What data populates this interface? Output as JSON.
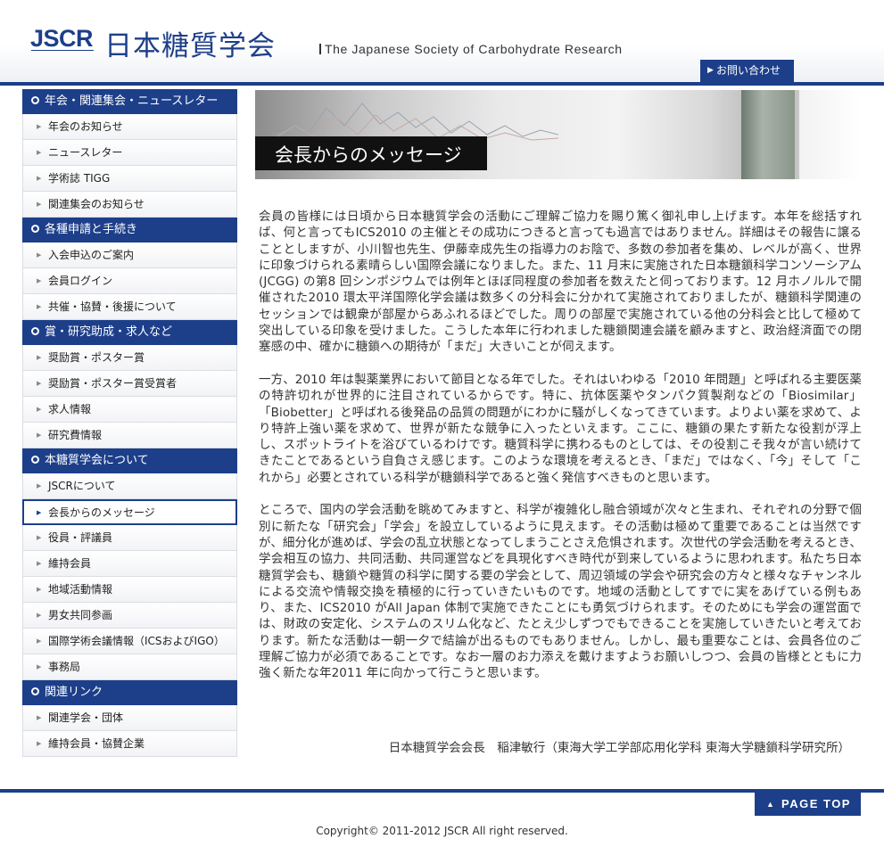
{
  "header": {
    "logo_mark": "JSCR",
    "logo_jp": "日本糖質学会",
    "logo_en": "The Japanese Society of Carbohydrate Research",
    "contact": "お問い合わせ"
  },
  "sidebar": [
    {
      "title": "年会・関連集会・ニュースレター",
      "items": [
        "年会のお知らせ",
        "ニュースレター",
        "学術誌 TIGG",
        "関連集会のお知らせ"
      ]
    },
    {
      "title": "各種申請と手続き",
      "items": [
        "入会申込のご案内",
        "会員ログイン",
        "共催・協賛・後援について"
      ]
    },
    {
      "title": "賞・研究助成・求人など",
      "items": [
        "奨励賞・ポスター賞",
        "奨励賞・ポスター賞受賞者",
        "求人情報",
        "研究費情報"
      ]
    },
    {
      "title": "本糖質学会について",
      "items": [
        "JSCRについて",
        "会長からのメッセージ",
        "役員・評議員",
        "維持会員",
        "地域活動情報",
        "男女共同参画",
        "国際学術会議情報（ICSおよびIGO）",
        "事務局"
      ]
    },
    {
      "title": "関連リンク",
      "items": [
        "関連学会・団体",
        "維持会員・協賛企業"
      ]
    }
  ],
  "active_item": "会長からのメッセージ",
  "hero": {
    "title": "会長からのメッセージ"
  },
  "content": {
    "paragraphs": [
      "会員の皆様には日頃から日本糖質学会の活動にご理解ご協力を賜り篤く御礼申し上げます。本年を総括すれば、何と言ってもICS2010 の主催とその成功につきると言っても過言ではありません。詳細はその報告に譲ることとしますが、小川智也先生、伊藤幸成先生の指導力のお陰で、多数の参加者を集め、レベルが高く、世界に印象づけられる素晴らしい国際会議になりました。また、11 月末に実施された日本糖鎖科学コンソーシアム(JCGG) の第8 回シンポジウムでは例年とほぼ同程度の参加者を数えたと伺っております。12 月ホノルルで開催された2010 環太平洋国際化学会議は数多くの分科会に分かれて実施されておりましたが、糖鎖科学関連のセッションでは観衆が部屋からあふれるほどでした。周りの部屋で実施されている他の分科会と比して極めて突出している印象を受けました。こうした本年に行われました糖鎖関連会議を顧みますと、政治経済面での閉塞感の中、確かに糖鎖への期待が「まだ」大きいことが伺えます。",
      "一方、2010 年は製薬業界において節目となる年でした。それはいわゆる「2010 年問題」と呼ばれる主要医薬の特許切れが世界的に注目されているからです。特に、抗体医薬やタンパク質製剤などの「Biosimilar」「Biobetter」と呼ばれる後発品の品質の問題がにわかに騒がしくなってきています。よりよい薬を求めて、より特許上強い薬を求めて、世界が新たな競争に入ったといえます。ここに、糖鎖の果たす新たな役割が浮上し、スポットライトを浴びているわけです。糖質科学に携わるものとしては、その役割こそ我々が言い続けてきたことであるという自負さえ感じます。このような環境を考えるとき、「まだ」ではなく、「今」そして「これから」必要とされている科学が糖鎖科学であると強く発信すべきものと思います。",
      "ところで、国内の学会活動を眺めてみますと、科学が複雑化し融合領域が次々と生まれ、それぞれの分野で個別に新たな「研究会」「学会」を設立しているように見えます。その活動は極めて重要であることは当然ですが、細分化が進めば、学会の乱立状態となってしまうことさえ危惧されます。次世代の学会活動を考えるとき、学会相互の協力、共同活動、共同運営などを具現化すべき時代が到来しているように思われます。私たち日本糖質学会も、糖鎖や糖質の科学に関する要の学会として、周辺領域の学会や研究会の方々と様々なチャンネルによる交流や情報交換を積極的に行っていきたいものです。地域の活動としてすでに実をあげている例もあり、また、ICS2010 がAll Japan 体制で実施できたことにも勇気づけられます。そのためにも学会の運営面では、財政の安定化、システムのスリム化など、たとえ少しずつでもできることを実施していきたいと考えております。新たな活動は一朝一夕で結論が出るものでもありません。しかし、最も重要なことは、会員各位のご理解ご協力が必須であることです。なお一層のお力添えを戴けますようお願いしつつ、会員の皆様とともに力強く新たな年2011 年に向かって行こうと思います。"
    ],
    "signature": "日本糖質学会会長　稲津敏行（東海大学工学部応用化学科 東海大学糖鎖科学研究所）"
  },
  "footer": {
    "pagetop": "PAGE TOP",
    "copyright": "Copyright© 2011-2012 JSCR All right reserved."
  },
  "colors": {
    "brand": "#1d3f8a"
  }
}
